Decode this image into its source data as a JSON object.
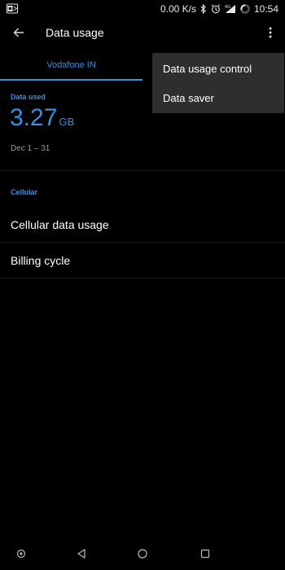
{
  "status_bar": {
    "speed": "0.00 K/s",
    "network_type": "4G",
    "time": "10:54"
  },
  "app_bar": {
    "title": "Data usage"
  },
  "tabs": [
    {
      "label": "Vodafone IN",
      "selected": true
    }
  ],
  "summary": {
    "label": "Data used",
    "value": "3.27",
    "unit": "GB",
    "date_range": "Dec 1 – 31"
  },
  "section": {
    "header": "Cellular"
  },
  "list_items": [
    {
      "label": "Cellular data usage"
    },
    {
      "label": "Billing cycle"
    }
  ],
  "popup_menu": {
    "items": [
      {
        "label": "Data usage control"
      },
      {
        "label": "Data saver"
      }
    ]
  },
  "colors": {
    "accent": "#3b8de0",
    "background": "#000000",
    "menu_background": "#2e2e2e"
  }
}
